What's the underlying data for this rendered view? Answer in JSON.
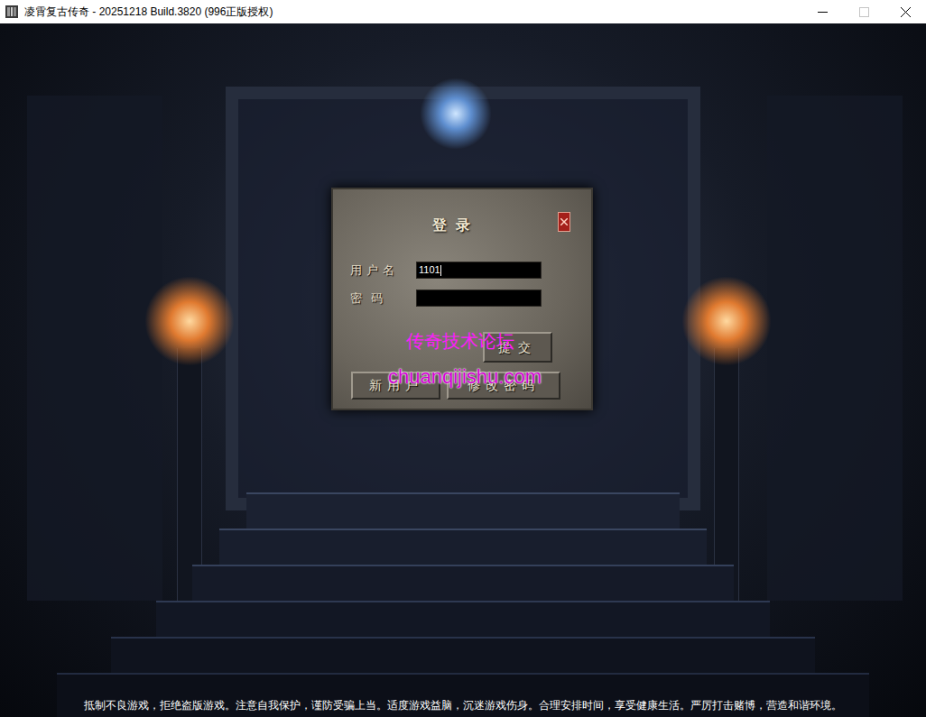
{
  "window": {
    "title": "凌霄复古传奇 - 20251218 Build.3820 (996正版授权)",
    "maximize_disabled": true
  },
  "login": {
    "title": "登录",
    "fields": [
      {
        "label": "用户名",
        "value": "1101",
        "focused": true
      },
      {
        "label": "密码",
        "value": "",
        "focused": false
      }
    ],
    "buttons": [
      "提交",
      "新用户",
      "修改密码"
    ]
  },
  "watermark": {
    "title": "传奇技术论坛",
    "url": "chuanqijishu.com"
  },
  "notice": "抵制不良游戏，拒绝盗版游戏。注意自我保护，谨防受骗上当。适度游戏益脑，沉迷游戏伤身。合理安排时间，享受健康生活。严厉打击赌博，营造和谐环境。"
}
